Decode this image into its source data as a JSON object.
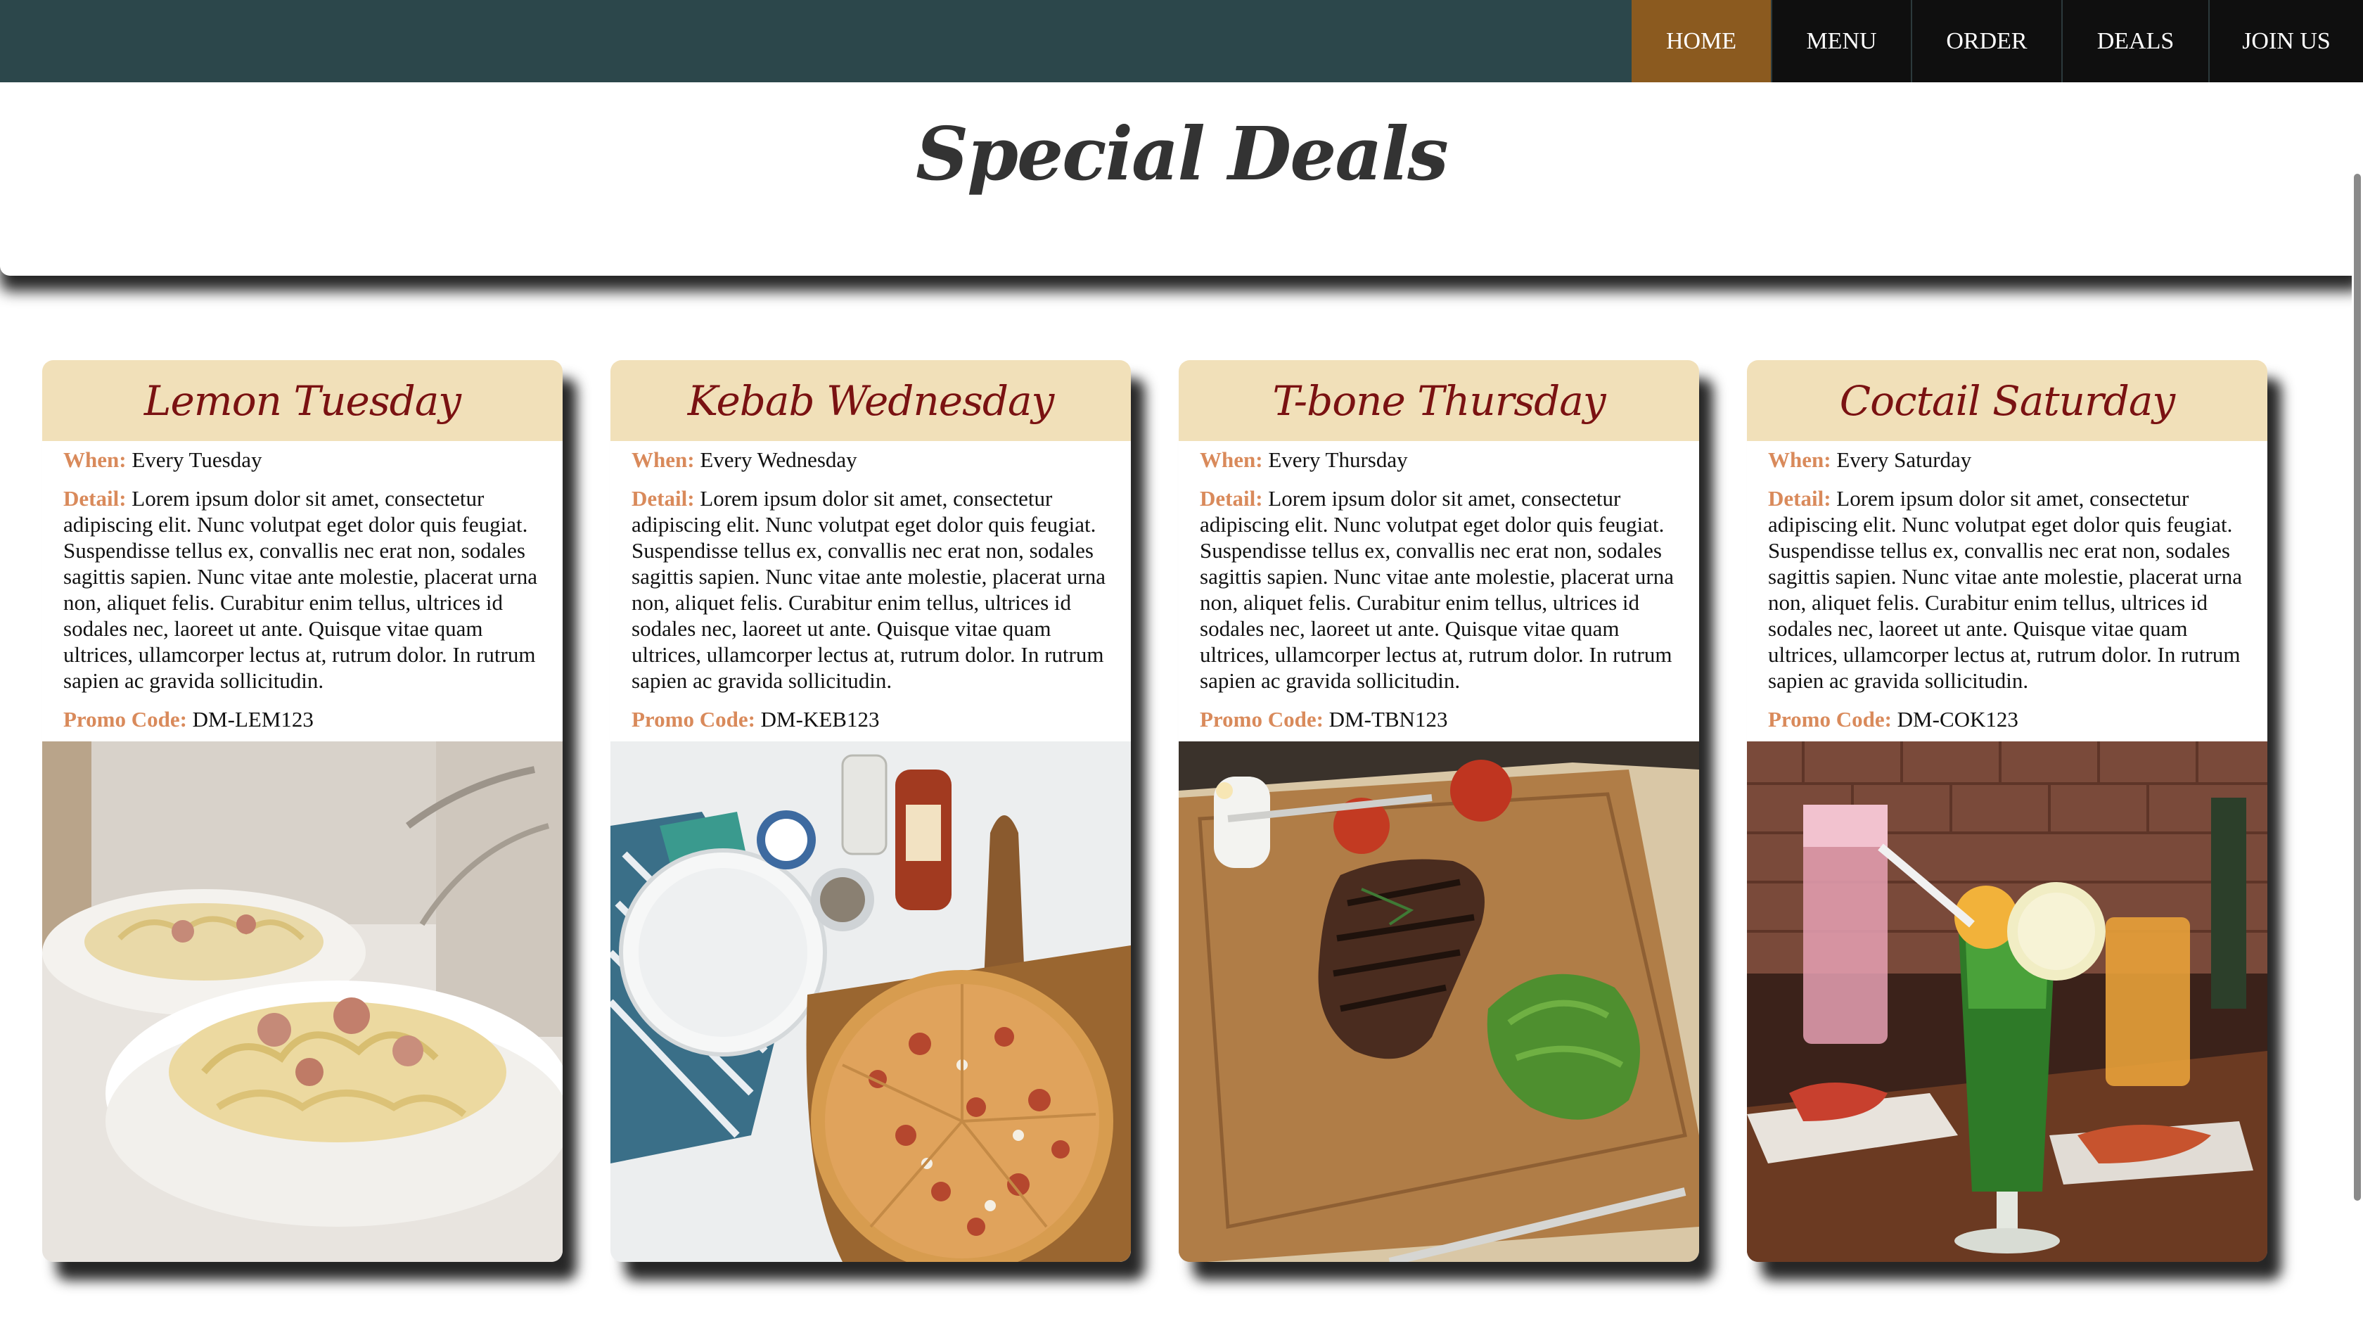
{
  "nav": {
    "items": [
      {
        "label": "HOME",
        "active": true
      },
      {
        "label": "MENU",
        "active": false
      },
      {
        "label": "ORDER",
        "active": false
      },
      {
        "label": "DEALS",
        "active": false
      },
      {
        "label": "JOIN US",
        "active": false
      }
    ]
  },
  "page": {
    "title": "Special Deals"
  },
  "labels": {
    "when": "When:",
    "detail": "Detail:",
    "promo": "Promo Code:"
  },
  "deals": [
    {
      "title": "Lemon Tuesday",
      "when": "Every Tuesday",
      "detail": "Lorem ipsum dolor sit amet, consectetur adipiscing elit. Nunc volutpat eget dolor quis feugiat. Suspendisse tellus ex, convallis nec erat non, sodales sagittis sapien. Nunc vitae ante molestie, placerat urna non, aliquet felis. Curabitur enim tellus, ultrices id sodales nec, laoreet ut ante. Quisque vitae quam ultrices, ullamcorper lectus at, rutrum dolor. In rutrum sapien ac gravida sollicitudin.",
      "promo": "DM-LEM123",
      "image": "pasta-carbonara-photo"
    },
    {
      "title": "Kebab Wednesday",
      "when": "Every Wednesday",
      "detail": "Lorem ipsum dolor sit amet, consectetur adipiscing elit. Nunc volutpat eget dolor quis feugiat. Suspendisse tellus ex, convallis nec erat non, sodales sagittis sapien. Nunc vitae ante molestie, placerat urna non, aliquet felis. Curabitur enim tellus, ultrices id sodales nec, laoreet ut ante. Quisque vitae quam ultrices, ullamcorper lectus at, rutrum dolor. In rutrum sapien ac gravida sollicitudin.",
      "promo": "DM-KEB123",
      "image": "pizza-board-photo"
    },
    {
      "title": "T-bone Thursday",
      "when": "Every Thursday",
      "detail": "Lorem ipsum dolor sit amet, consectetur adipiscing elit. Nunc volutpat eget dolor quis feugiat. Suspendisse tellus ex, convallis nec erat non, sodales sagittis sapien. Nunc vitae ante molestie, placerat urna non, aliquet felis. Curabitur enim tellus, ultrices id sodales nec, laoreet ut ante. Quisque vitae quam ultrices, ullamcorper lectus at, rutrum dolor. In rutrum sapien ac gravida sollicitudin.",
      "promo": "DM-TBN123",
      "image": "steak-board-photo"
    },
    {
      "title": "Coctail Saturday",
      "when": "Every Saturday",
      "detail": "Lorem ipsum dolor sit amet, consectetur adipiscing elit. Nunc volutpat eget dolor quis feugiat. Suspendisse tellus ex, convallis nec erat non, sodales sagittis sapien. Nunc vitae ante molestie, placerat urna non, aliquet felis. Curabitur enim tellus, ultrices id sodales nec, laoreet ut ante. Quisque vitae quam ultrices, ullamcorper lectus at, rutrum dolor. In rutrum sapien ac gravida sollicitudin.",
      "promo": "DM-COK123",
      "image": "cocktail-glass-photo"
    }
  ],
  "colors": {
    "navbar": "#2c474b",
    "nav_active": "#8b5a1f",
    "card_header": "#f1e0b9",
    "card_title": "#7a1212",
    "label": "#d98a5b"
  }
}
